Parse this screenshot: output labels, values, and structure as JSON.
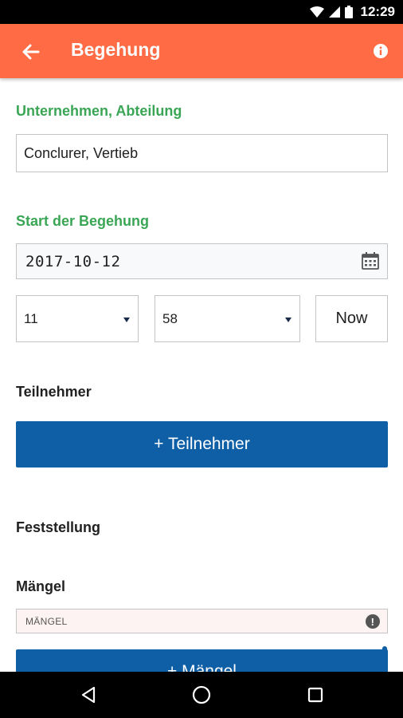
{
  "status_bar": {
    "time": "12:29",
    "icons": [
      "wifi-icon",
      "signal-icon",
      "battery-icon"
    ]
  },
  "app_bar": {
    "title": "Begehung",
    "back_icon": "arrow-left-icon",
    "info_icon": "info-icon",
    "color": "#FF6B45"
  },
  "form": {
    "unternehmen_label": "Unternehmen, Abteilung",
    "unternehmen_value": "Conclurer, Vertieb",
    "start_label": "Start der Begehung",
    "date_value": "2017-10-12",
    "hour_value": "11",
    "minute_value": "58",
    "now_label": "Now",
    "teilnehmer_heading": "Teilnehmer",
    "teilnehmer_button": "+ Teilnehmer",
    "feststellung_heading": "Feststellung",
    "maengel_heading": "Mängel",
    "maengel_placeholder": "MÄNGEL",
    "maengel_button": "+ Mängel"
  },
  "colors": {
    "accent_green": "#3AA655",
    "primary_blue": "#0F5FA6"
  }
}
